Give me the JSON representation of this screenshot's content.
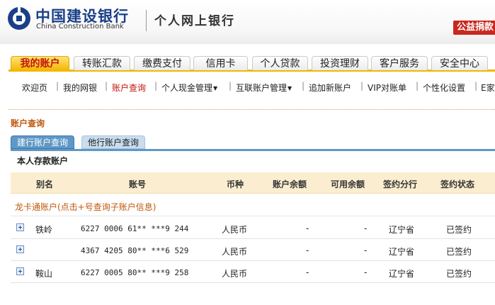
{
  "header": {
    "bank_name_cn": "中国建设银行",
    "bank_name_en": "China Construction Bank",
    "product": "个人网上银行",
    "donate_label": "公益捐款"
  },
  "main_tabs": [
    "我的账户",
    "转账汇款",
    "缴费支付",
    "信用卡",
    "个人贷款",
    "投资理财",
    "客户服务",
    "安全中心"
  ],
  "sub_nav": [
    {
      "label": "欢迎页",
      "dropdown": false
    },
    {
      "label": "我的网银",
      "dropdown": false
    },
    {
      "label": "账户查询",
      "dropdown": false,
      "current": true
    },
    {
      "label": "个人现金管理",
      "dropdown": true
    },
    {
      "label": "互联账户管理",
      "dropdown": true
    },
    {
      "label": "追加新账户",
      "dropdown": false
    },
    {
      "label": "VIP对账单",
      "dropdown": false
    },
    {
      "label": "个性化设置",
      "dropdown": false
    },
    {
      "label": "E家",
      "dropdown": false
    }
  ],
  "section_title": "账户查询",
  "query_tabs": {
    "ccb": "建行账户查询",
    "other": "他行账户查询"
  },
  "account_heading": "本人存款账户",
  "table": {
    "headers": [
      "别名",
      "账号",
      "币种",
      "账户余额",
      "可用余额",
      "签约分行",
      "签约状态"
    ],
    "group_label": "龙卡通账户(点击+号查询子账户信息)",
    "rows": [
      {
        "alias": "铁岭",
        "account": "6227 0006 61** ***9 244",
        "currency": "人民币",
        "balance": "-",
        "available": "-",
        "branch": "辽宁省",
        "status": "已签约"
      },
      {
        "alias": "",
        "account": "4367 4205 80** ***6 529",
        "currency": "人民币",
        "balance": "-",
        "available": "-",
        "branch": "辽宁省",
        "status": "已签约"
      },
      {
        "alias": "鞍山",
        "account": "6227 0005 80** ***9 258",
        "currency": "人民币",
        "balance": "-",
        "available": "-",
        "branch": "辽宁省",
        "status": "已签约"
      }
    ]
  },
  "colors": {
    "brand_blue": "#1a3f88",
    "accent_orange": "#f6b700",
    "link_red": "#c0160b"
  }
}
